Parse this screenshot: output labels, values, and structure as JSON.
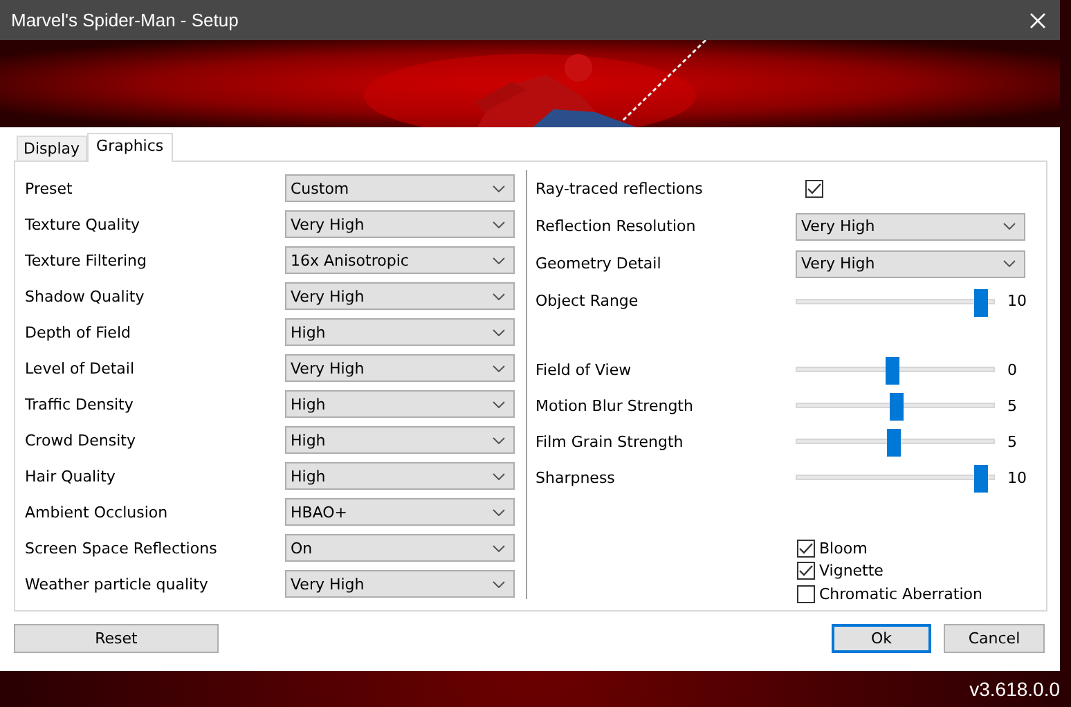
{
  "window": {
    "title": "Marvel's Spider-Man - Setup"
  },
  "tabs": [
    {
      "label": "Display",
      "selected": false
    },
    {
      "label": "Graphics",
      "selected": true
    }
  ],
  "left_settings": [
    {
      "label": "Preset",
      "value": "Custom"
    },
    {
      "label": "Texture Quality",
      "value": "Very High"
    },
    {
      "label": "Texture Filtering",
      "value": "16x Anisotropic"
    },
    {
      "label": "Shadow Quality",
      "value": "Very High"
    },
    {
      "label": "Depth of Field",
      "value": "High"
    },
    {
      "label": "Level of Detail",
      "value": "Very High"
    },
    {
      "label": "Traffic Density",
      "value": "High"
    },
    {
      "label": "Crowd Density",
      "value": "High"
    },
    {
      "label": "Hair Quality",
      "value": "High"
    },
    {
      "label": "Ambient Occlusion",
      "value": "HBAO+"
    },
    {
      "label": "Screen Space Reflections",
      "value": "On"
    },
    {
      "label": "Weather particle quality",
      "value": "Very High"
    }
  ],
  "right_settings": [
    {
      "kind": "checkbox",
      "label": "Ray-traced reflections",
      "checked": true
    },
    {
      "kind": "dropdown",
      "label": "Reflection Resolution",
      "value": "Very High"
    },
    {
      "kind": "dropdown",
      "label": "Geometry Detail",
      "value": "Very High"
    },
    {
      "kind": "slider",
      "label": "Object Range",
      "level": 1,
      "reading": "10"
    }
  ],
  "sliders": [
    {
      "label": "Field of View",
      "level": 0.5,
      "reading": "0"
    },
    {
      "label": "Motion Blur Strength",
      "level": 0.52,
      "reading": "5"
    },
    {
      "label": "Film Grain Strength",
      "level": 0.51,
      "reading": "5"
    },
    {
      "label": "Sharpness",
      "level": 1,
      "reading": "10"
    }
  ],
  "effects": [
    {
      "label": "Bloom",
      "checked": true
    },
    {
      "label": "Vignette",
      "checked": true
    },
    {
      "label": "Chromatic Aberration",
      "checked": false
    }
  ],
  "buttons": {
    "reset": "Reset",
    "ok": "Ok",
    "cancel": "Cancel"
  },
  "version": "v3.618.0.0"
}
